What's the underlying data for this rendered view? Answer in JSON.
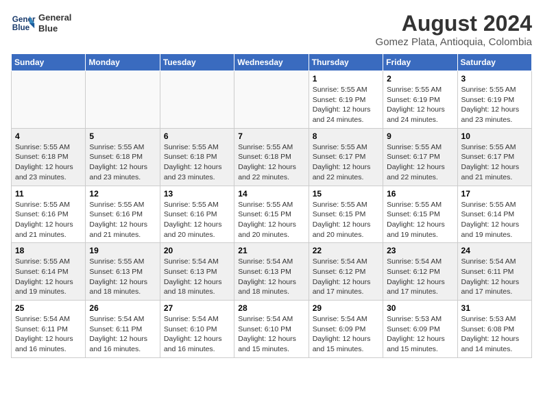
{
  "header": {
    "logo_line1": "General",
    "logo_line2": "Blue",
    "month_year": "August 2024",
    "location": "Gomez Plata, Antioquia, Colombia"
  },
  "days_of_week": [
    "Sunday",
    "Monday",
    "Tuesday",
    "Wednesday",
    "Thursday",
    "Friday",
    "Saturday"
  ],
  "weeks": [
    [
      {
        "day": "",
        "info": ""
      },
      {
        "day": "",
        "info": ""
      },
      {
        "day": "",
        "info": ""
      },
      {
        "day": "",
        "info": ""
      },
      {
        "day": "1",
        "info": "Sunrise: 5:55 AM\nSunset: 6:19 PM\nDaylight: 12 hours\nand 24 minutes."
      },
      {
        "day": "2",
        "info": "Sunrise: 5:55 AM\nSunset: 6:19 PM\nDaylight: 12 hours\nand 24 minutes."
      },
      {
        "day": "3",
        "info": "Sunrise: 5:55 AM\nSunset: 6:19 PM\nDaylight: 12 hours\nand 23 minutes."
      }
    ],
    [
      {
        "day": "4",
        "info": "Sunrise: 5:55 AM\nSunset: 6:18 PM\nDaylight: 12 hours\nand 23 minutes."
      },
      {
        "day": "5",
        "info": "Sunrise: 5:55 AM\nSunset: 6:18 PM\nDaylight: 12 hours\nand 23 minutes."
      },
      {
        "day": "6",
        "info": "Sunrise: 5:55 AM\nSunset: 6:18 PM\nDaylight: 12 hours\nand 23 minutes."
      },
      {
        "day": "7",
        "info": "Sunrise: 5:55 AM\nSunset: 6:18 PM\nDaylight: 12 hours\nand 22 minutes."
      },
      {
        "day": "8",
        "info": "Sunrise: 5:55 AM\nSunset: 6:17 PM\nDaylight: 12 hours\nand 22 minutes."
      },
      {
        "day": "9",
        "info": "Sunrise: 5:55 AM\nSunset: 6:17 PM\nDaylight: 12 hours\nand 22 minutes."
      },
      {
        "day": "10",
        "info": "Sunrise: 5:55 AM\nSunset: 6:17 PM\nDaylight: 12 hours\nand 21 minutes."
      }
    ],
    [
      {
        "day": "11",
        "info": "Sunrise: 5:55 AM\nSunset: 6:16 PM\nDaylight: 12 hours\nand 21 minutes."
      },
      {
        "day": "12",
        "info": "Sunrise: 5:55 AM\nSunset: 6:16 PM\nDaylight: 12 hours\nand 21 minutes."
      },
      {
        "day": "13",
        "info": "Sunrise: 5:55 AM\nSunset: 6:16 PM\nDaylight: 12 hours\nand 20 minutes."
      },
      {
        "day": "14",
        "info": "Sunrise: 5:55 AM\nSunset: 6:15 PM\nDaylight: 12 hours\nand 20 minutes."
      },
      {
        "day": "15",
        "info": "Sunrise: 5:55 AM\nSunset: 6:15 PM\nDaylight: 12 hours\nand 20 minutes."
      },
      {
        "day": "16",
        "info": "Sunrise: 5:55 AM\nSunset: 6:15 PM\nDaylight: 12 hours\nand 19 minutes."
      },
      {
        "day": "17",
        "info": "Sunrise: 5:55 AM\nSunset: 6:14 PM\nDaylight: 12 hours\nand 19 minutes."
      }
    ],
    [
      {
        "day": "18",
        "info": "Sunrise: 5:55 AM\nSunset: 6:14 PM\nDaylight: 12 hours\nand 19 minutes."
      },
      {
        "day": "19",
        "info": "Sunrise: 5:55 AM\nSunset: 6:13 PM\nDaylight: 12 hours\nand 18 minutes."
      },
      {
        "day": "20",
        "info": "Sunrise: 5:54 AM\nSunset: 6:13 PM\nDaylight: 12 hours\nand 18 minutes."
      },
      {
        "day": "21",
        "info": "Sunrise: 5:54 AM\nSunset: 6:13 PM\nDaylight: 12 hours\nand 18 minutes."
      },
      {
        "day": "22",
        "info": "Sunrise: 5:54 AM\nSunset: 6:12 PM\nDaylight: 12 hours\nand 17 minutes."
      },
      {
        "day": "23",
        "info": "Sunrise: 5:54 AM\nSunset: 6:12 PM\nDaylight: 12 hours\nand 17 minutes."
      },
      {
        "day": "24",
        "info": "Sunrise: 5:54 AM\nSunset: 6:11 PM\nDaylight: 12 hours\nand 17 minutes."
      }
    ],
    [
      {
        "day": "25",
        "info": "Sunrise: 5:54 AM\nSunset: 6:11 PM\nDaylight: 12 hours\nand 16 minutes."
      },
      {
        "day": "26",
        "info": "Sunrise: 5:54 AM\nSunset: 6:11 PM\nDaylight: 12 hours\nand 16 minutes."
      },
      {
        "day": "27",
        "info": "Sunrise: 5:54 AM\nSunset: 6:10 PM\nDaylight: 12 hours\nand 16 minutes."
      },
      {
        "day": "28",
        "info": "Sunrise: 5:54 AM\nSunset: 6:10 PM\nDaylight: 12 hours\nand 15 minutes."
      },
      {
        "day": "29",
        "info": "Sunrise: 5:54 AM\nSunset: 6:09 PM\nDaylight: 12 hours\nand 15 minutes."
      },
      {
        "day": "30",
        "info": "Sunrise: 5:53 AM\nSunset: 6:09 PM\nDaylight: 12 hours\nand 15 minutes."
      },
      {
        "day": "31",
        "info": "Sunrise: 5:53 AM\nSunset: 6:08 PM\nDaylight: 12 hours\nand 14 minutes."
      }
    ]
  ]
}
